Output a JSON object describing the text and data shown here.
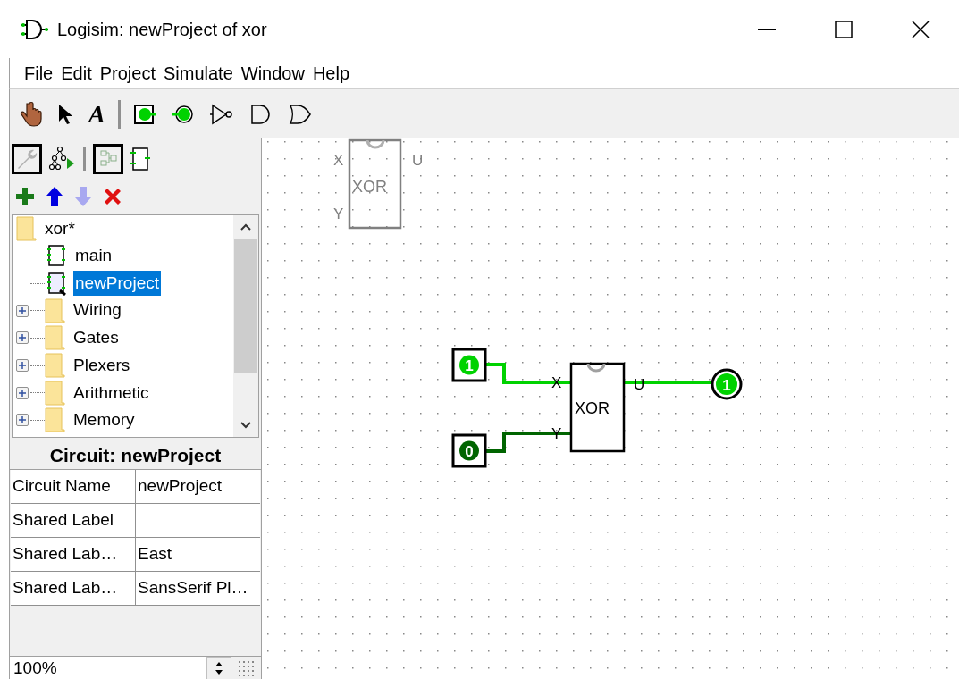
{
  "window": {
    "title": "Logisim: newProject of xor"
  },
  "menu": [
    "File",
    "Edit",
    "Project",
    "Simulate",
    "Window",
    "Help"
  ],
  "toolbar": {
    "text_tool": "A"
  },
  "tree": {
    "label": "xor*",
    "expanded": true,
    "children": [
      {
        "kind": "circuit",
        "label": "main",
        "selected": false
      },
      {
        "kind": "circuit",
        "label": "newProject",
        "selected": true
      },
      {
        "kind": "library",
        "label": "Wiring",
        "selected": false,
        "expanded": false
      },
      {
        "kind": "library",
        "label": "Gates",
        "selected": false,
        "expanded": false
      },
      {
        "kind": "library",
        "label": "Plexers",
        "selected": false,
        "expanded": false
      },
      {
        "kind": "library",
        "label": "Arithmetic",
        "selected": false,
        "expanded": false
      },
      {
        "kind": "library",
        "label": "Memory",
        "selected": false,
        "expanded": false
      }
    ]
  },
  "attributes": {
    "title": "Circuit: newProject",
    "rows": [
      {
        "name": "Circuit Name",
        "value": "newProject"
      },
      {
        "name": "Shared Label",
        "value": ""
      },
      {
        "name": "Shared Lab…",
        "value": "East"
      },
      {
        "name": "Shared Lab…",
        "value": "SansSerif Pl…"
      }
    ]
  },
  "zoom": "100%",
  "canvas": {
    "ghost": {
      "label": "XOR",
      "inputs": [
        "X",
        "Y"
      ],
      "output": "U"
    },
    "subcircuit": {
      "label": "XOR",
      "inputs": [
        "X",
        "Y"
      ],
      "output": "U"
    },
    "input_pins": [
      {
        "value": "1",
        "high": true
      },
      {
        "value": "0",
        "high": false
      }
    ],
    "output_pin": {
      "value": "1",
      "high": true
    }
  }
}
